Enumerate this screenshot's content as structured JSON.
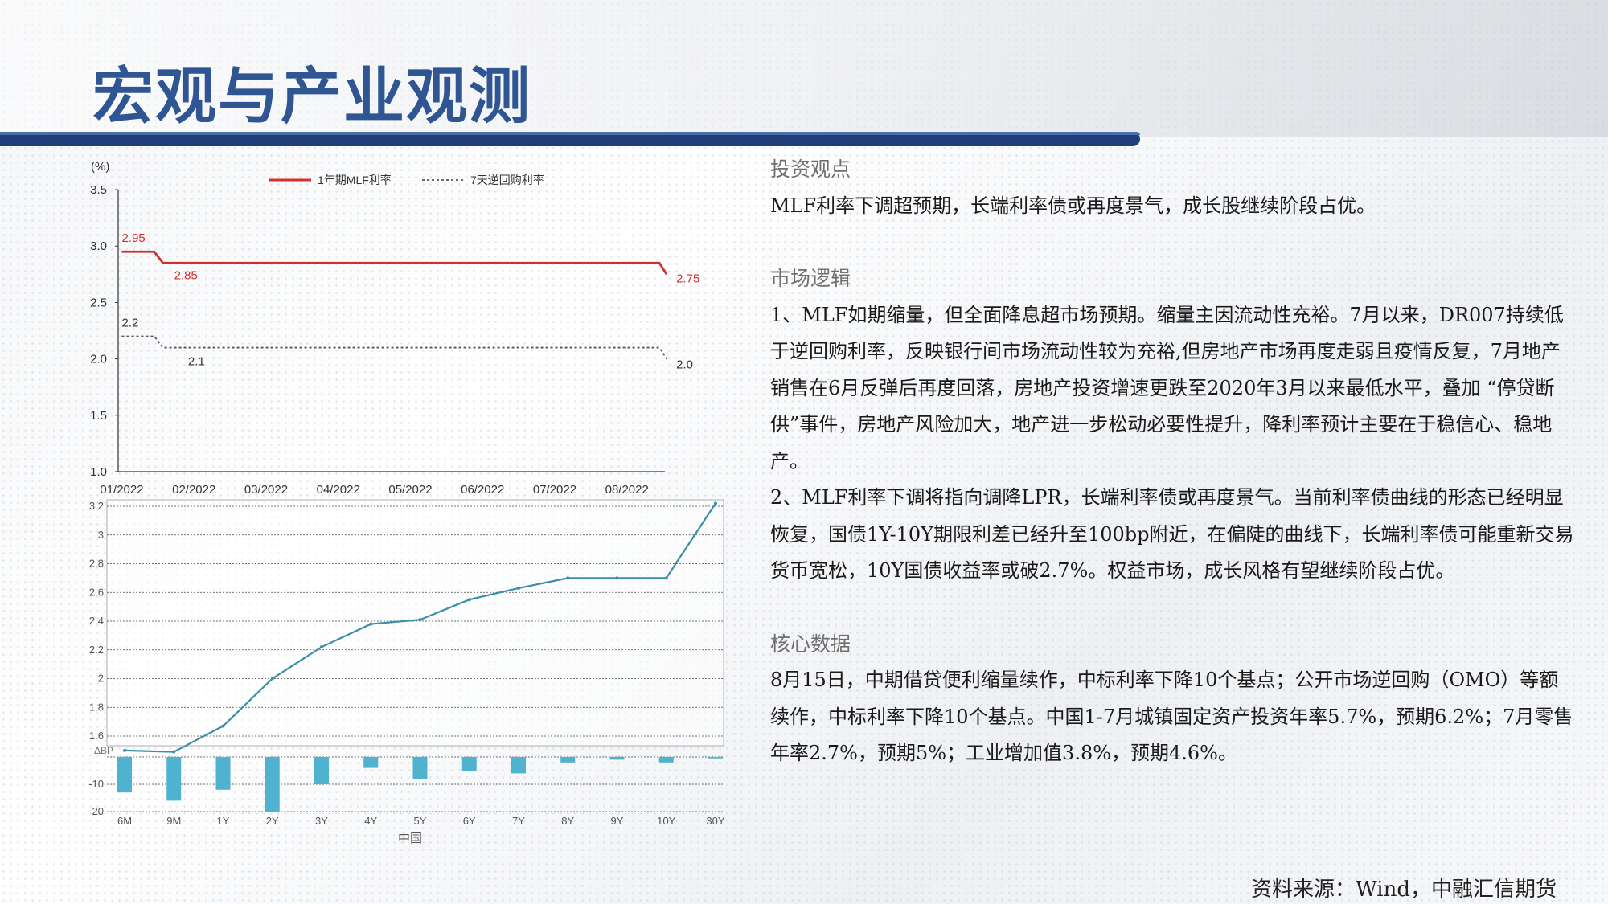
{
  "slide": {
    "title": "宏观与产业观测",
    "source": "资料来源：Wind，中融汇信期货"
  },
  "colors": {
    "title": "#2f5592",
    "bar": "#1f3d7a",
    "mlf": "#d32f2f",
    "reverse_repo": "#555555",
    "yield_curve": "#3a8fa6",
    "bars": "#4fb3cf"
  },
  "text": {
    "view_head": "投资观点",
    "view_body": "MLF利率下调超预期，长端利率债或再度景气，成长股继续阶段占优。",
    "logic_head": "市场逻辑",
    "logic_p1": "1、MLF如期缩量，但全面降息超市场预期。缩量主因流动性充裕。7月以来，DR007持续低于逆回购利率，反映银行间市场流动性较为充裕,但房地产市场再度走弱且疫情反复，7月地产销售在6月反弹后再度回落，房地产投资增速更跌至2020年3月以来最低水平，叠加 “停贷断供”事件，房地产风险加大，地产进一步松动必要性提升，降利率预计主要在于稳信心、稳地产。",
    "logic_p2": "2、MLF利率下调将指向调降LPR，长端利率债或再度景气。当前利率债曲线的形态已经明显恢复，国债1Y-10Y期限利差已经升至100bp附近，在偏陡的曲线下，长端利率债可能重新交易货币宽松，10Y国债收益率或破2.7%。权益市场，成长风格有望继续阶段占优。",
    "data_head": "核心数据",
    "data_body": "8月15日，中期借贷便利缩量续作，中标利率下降10个基点；公开市场逆回购（OMO）等额续作，中标利率下降10个基点。中国1-7月城镇固定资产投资年率5.7%，预期6.2%；7月零售年率2.7%，预期5%；工业增加值3.8%，预期4.6%。"
  },
  "chart_data": [
    {
      "type": "line",
      "ylabel": "(%)",
      "ylim": [
        1.0,
        3.5
      ],
      "yticks": [
        "1.0",
        "1.5",
        "2.0",
        "2.5",
        "3.0",
        "3.5"
      ],
      "xlim": [
        0,
        8
      ],
      "xticks": [
        "01/2022",
        "02/2022",
        "03/2022",
        "04/2022",
        "05/2022",
        "06/2022",
        "07/2022",
        "08/2022"
      ],
      "series": [
        {
          "name": "1年期MLF利率",
          "style": "solid",
          "x": [
            0.05,
            0.5,
            0.62,
            7.5,
            7.6
          ],
          "y": [
            2.95,
            2.95,
            2.85,
            2.85,
            2.75
          ]
        },
        {
          "name": "7天逆回购利率",
          "style": "dotted",
          "x": [
            0.05,
            0.5,
            0.62,
            7.5,
            7.6
          ],
          "y": [
            2.2,
            2.2,
            2.1,
            2.1,
            2.0
          ]
        }
      ],
      "annotations": [
        {
          "text": "2.95",
          "x": 0.05,
          "y": 2.95,
          "series": 0
        },
        {
          "text": "2.85",
          "x": 0.62,
          "y": 2.85,
          "series": 0
        },
        {
          "text": "2.75",
          "x": 7.6,
          "y": 2.75,
          "series": 0
        },
        {
          "text": "2.2",
          "x": 0.05,
          "y": 2.2,
          "series": 1
        },
        {
          "text": "2.1",
          "x": 0.5,
          "y": 2.1,
          "series": 1
        },
        {
          "text": "2.0",
          "x": 7.6,
          "y": 2.0,
          "series": 1
        }
      ]
    },
    {
      "type": "line",
      "ylim": [
        1.6,
        3.2
      ],
      "yticks": [
        "1.6",
        "1.8",
        "2",
        "2.2",
        "2.4",
        "2.6",
        "2.8",
        "3",
        "3.2"
      ],
      "categories": [
        "6M",
        "9M",
        "1Y",
        "2Y",
        "3Y",
        "4Y",
        "5Y",
        "6Y",
        "7Y",
        "8Y",
        "9Y",
        "10Y",
        "30Y"
      ],
      "xlabel": "中国",
      "series": [
        {
          "values": [
            1.5,
            1.49,
            1.67,
            2.0,
            2.22,
            2.38,
            2.41,
            2.55,
            2.63,
            2.7,
            2.7,
            2.7,
            3.22
          ]
        }
      ]
    },
    {
      "type": "bar",
      "ylabel": "ΔBP",
      "ylim": [
        -20,
        0
      ],
      "yticks": [
        "-10",
        "-20"
      ],
      "categories": [
        "6M",
        "9M",
        "1Y",
        "2Y",
        "3Y",
        "4Y",
        "5Y",
        "6Y",
        "7Y",
        "8Y",
        "9Y",
        "10Y",
        "30Y"
      ],
      "values": [
        -13,
        -16,
        -12,
        -20,
        -10,
        -4,
        -8,
        -5,
        -6,
        -2,
        -1,
        -2,
        -0.5
      ]
    }
  ]
}
